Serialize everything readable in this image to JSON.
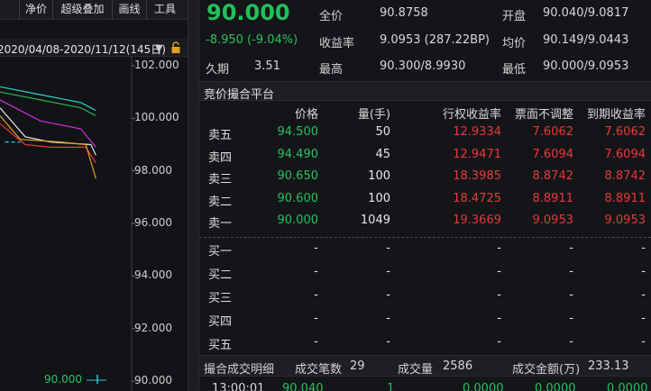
{
  "toolbar": {
    "first": "",
    "jingjia": "净价",
    "chaoji": "超级叠加",
    "huaxian": "画线",
    "gongju": "工具"
  },
  "range_bar": {
    "text": "2020/04/08-2020/11/12(145日)",
    "arrow": "▼"
  },
  "chart_data": {
    "type": "line",
    "yticks": [
      "102.000",
      "100.000",
      "98.000",
      "96.000",
      "94.000",
      "92.000",
      "90.000"
    ],
    "ylim": [
      90,
      102
    ],
    "xlim": [
      0,
      20
    ],
    "bottom_label": "90.000",
    "series": [
      {
        "color": "#2fd4c4",
        "points": [
          [
            0,
            101.2
          ],
          [
            8,
            100.9
          ],
          [
            16,
            100.6
          ],
          [
            19,
            100.3
          ]
        ]
      },
      {
        "color": "#2bb24c",
        "points": [
          [
            0,
            101.0
          ],
          [
            8,
            100.7
          ],
          [
            16,
            100.4
          ],
          [
            19,
            100.1
          ]
        ]
      },
      {
        "color": "#d62fd6",
        "points": [
          [
            0,
            100.7
          ],
          [
            8,
            99.9
          ],
          [
            16,
            99.6
          ],
          [
            19,
            98.9
          ]
        ]
      },
      {
        "color": "#e5e5e5",
        "points": [
          [
            0,
            100.4
          ],
          [
            5,
            99.3
          ],
          [
            10,
            99.1
          ],
          [
            18,
            99.0
          ],
          [
            19,
            98.6
          ]
        ]
      },
      {
        "color": "#e8393a",
        "points": [
          [
            0,
            99.8
          ],
          [
            5,
            99.0
          ],
          [
            10,
            98.9
          ],
          [
            17,
            98.9
          ],
          [
            19,
            98.3
          ]
        ]
      },
      {
        "color": "#e0a020",
        "points": [
          [
            0,
            100.1
          ],
          [
            4,
            99.2
          ],
          [
            12,
            99.1
          ],
          [
            17,
            99.0
          ],
          [
            19,
            97.7
          ]
        ]
      },
      {
        "color": "#2bc6d8",
        "dashed": true,
        "points": [
          [
            1,
            99.1
          ],
          [
            4,
            99.1
          ]
        ]
      }
    ]
  },
  "header": {
    "last_price": "90.000",
    "change": "-8.950 (-9.04%)",
    "duration_label": "久期",
    "duration": "3.51",
    "full_price_label": "全价",
    "full_price": "90.8758",
    "yield_label": "收益率",
    "yield": "9.0953 (287.22BP)",
    "high_label": "最高",
    "high": "90.300/8.9930",
    "open_label": "开盘",
    "open": "90.040/9.0817",
    "avg_label": "均价",
    "avg": "90.149/9.0443",
    "low_label": "最低",
    "low": "90.000/9.0953"
  },
  "book": {
    "title": "竞价撮合平台",
    "columns": [
      "价格",
      "量(手)",
      "行权收益率",
      "票面不调整",
      "到期收益率"
    ],
    "asks": [
      {
        "label": "卖五",
        "price": "94.500",
        "qty": "50",
        "exercise": "12.9334",
        "coupon": "7.6062",
        "ytm": "7.6062"
      },
      {
        "label": "卖四",
        "price": "94.490",
        "qty": "45",
        "exercise": "12.9471",
        "coupon": "7.6094",
        "ytm": "7.6094"
      },
      {
        "label": "卖三",
        "price": "90.650",
        "qty": "100",
        "exercise": "18.3985",
        "coupon": "8.8742",
        "ytm": "8.8742"
      },
      {
        "label": "卖二",
        "price": "90.600",
        "qty": "100",
        "exercise": "18.4725",
        "coupon": "8.8911",
        "ytm": "8.8911"
      },
      {
        "label": "卖一",
        "price": "90.000",
        "qty": "1049",
        "exercise": "19.3669",
        "coupon": "9.0953",
        "ytm": "9.0953"
      }
    ],
    "bids": [
      {
        "label": "买一",
        "price": "-",
        "qty": "-",
        "exercise": "-",
        "coupon": "-",
        "ytm": "-"
      },
      {
        "label": "买二",
        "price": "-",
        "qty": "-",
        "exercise": "-",
        "coupon": "-",
        "ytm": "-"
      },
      {
        "label": "买三",
        "price": "-",
        "qty": "-",
        "exercise": "-",
        "coupon": "-",
        "ytm": "-"
      },
      {
        "label": "买四",
        "price": "-",
        "qty": "-",
        "exercise": "-",
        "coupon": "-",
        "ytm": "-"
      },
      {
        "label": "买五",
        "price": "-",
        "qty": "-",
        "exercise": "-",
        "coupon": "-",
        "ytm": "-"
      }
    ]
  },
  "deals": {
    "title": "撮合成交明细",
    "count_label": "成交笔数",
    "count": "29",
    "volume_label": "成交量",
    "volume": "2586",
    "amount_label": "成交金额(万)",
    "amount": "233.13",
    "row": {
      "time": "13:00:01",
      "price": "90.040",
      "qty": "1",
      "c1": "0.0000",
      "c2": "0.0000",
      "c3": "0.0000"
    }
  }
}
